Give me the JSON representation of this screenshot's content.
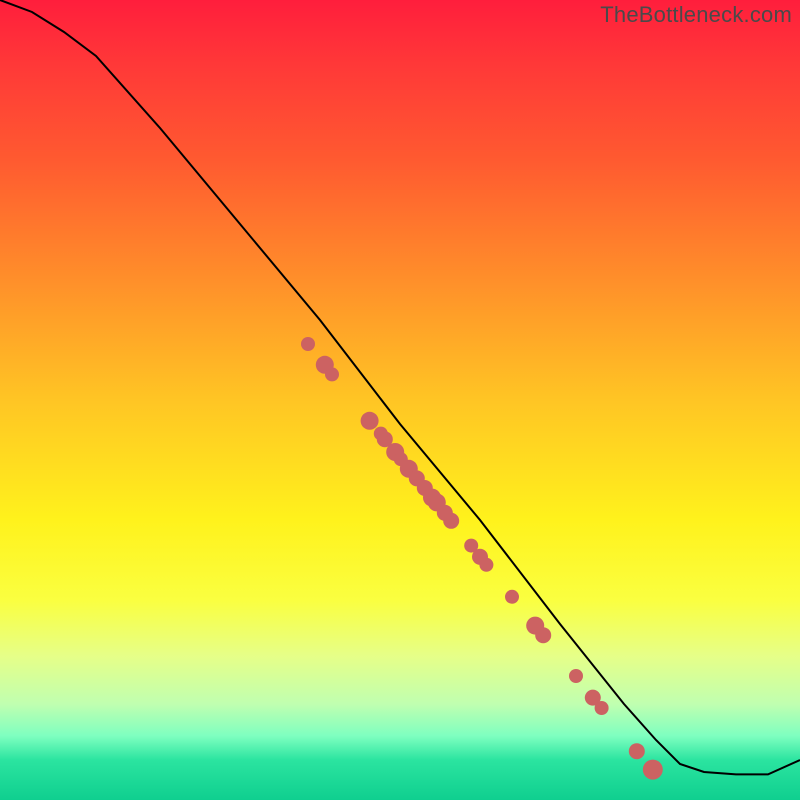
{
  "watermark": "TheBottleneck.com",
  "colors": {
    "curve": "#000000",
    "dot": "#cc6262",
    "gradient_top": "#ff1e3c",
    "gradient_bottom": "#0fcf8f"
  },
  "chart_data": {
    "type": "line",
    "title": "",
    "xlabel": "",
    "ylabel": "",
    "xlim": [
      0,
      100
    ],
    "ylim": [
      0,
      100
    ],
    "curve": {
      "x": [
        0,
        4,
        8,
        12,
        20,
        30,
        40,
        50,
        60,
        70,
        78,
        82,
        85,
        88,
        92,
        96,
        100
      ],
      "y": [
        100,
        98.5,
        96,
        93,
        84,
        72,
        60,
        47,
        35,
        22,
        12,
        7.5,
        4.5,
        3.5,
        3.2,
        3.2,
        5
      ]
    },
    "series": [
      {
        "name": "scatter-points",
        "x": [
          38.5,
          40.6,
          41.5,
          46.2,
          47.6,
          48.1,
          49.4,
          50.1,
          51.1,
          52.1,
          53.1,
          54,
          54.6,
          55.6,
          56.4,
          58.9,
          60,
          60.8,
          64,
          66.9,
          67.9,
          72,
          74.1,
          75.2,
          79.6,
          81.6
        ],
        "y": [
          57,
          54.4,
          53.2,
          47.4,
          45.8,
          45.1,
          43.5,
          42.6,
          41.4,
          40.2,
          39,
          37.8,
          37.2,
          35.9,
          34.9,
          31.8,
          30.4,
          29.4,
          25.4,
          21.8,
          20.6,
          15.5,
          12.8,
          11.5,
          6.1,
          3.8
        ],
        "r": [
          7,
          9,
          7,
          9,
          7,
          8,
          9,
          7,
          9,
          8,
          8,
          9,
          9,
          8,
          8,
          7,
          8,
          7,
          7,
          9,
          8,
          7,
          8,
          7,
          8,
          10
        ]
      }
    ]
  }
}
